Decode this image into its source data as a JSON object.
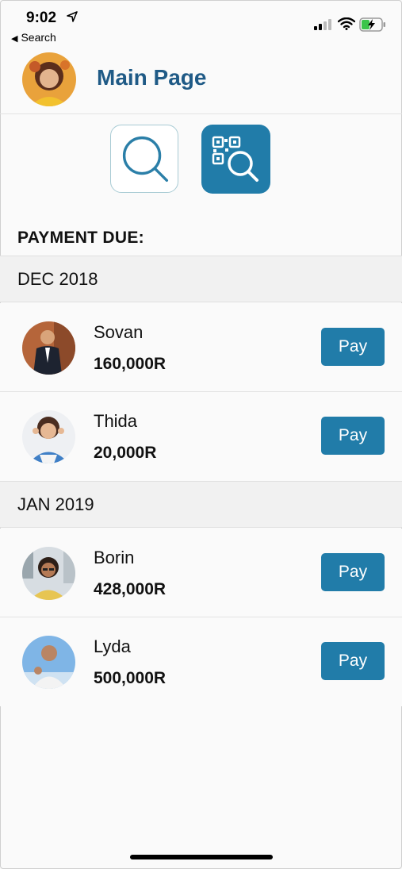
{
  "status_bar": {
    "time": "9:02",
    "back_label": "Search"
  },
  "header": {
    "title": "Main Page"
  },
  "actions": {
    "search_icon": "search-icon",
    "qr_icon": "qr-search-icon"
  },
  "section": {
    "heading": "PAYMENT DUE:"
  },
  "colors": {
    "accent": "#217ca9",
    "title": "#1f5a86",
    "group_bg": "#f1f1f1"
  },
  "groups": [
    {
      "label": "DEC 2018",
      "items": [
        {
          "name": "Sovan",
          "amount": "160,000R",
          "button": "Pay"
        },
        {
          "name": "Thida",
          "amount": "20,000R",
          "button": "Pay"
        }
      ]
    },
    {
      "label": "JAN 2019",
      "items": [
        {
          "name": "Borin",
          "amount": "428,000R",
          "button": "Pay"
        },
        {
          "name": "Lyda",
          "amount": "500,000R",
          "button": "Pay"
        }
      ]
    }
  ]
}
